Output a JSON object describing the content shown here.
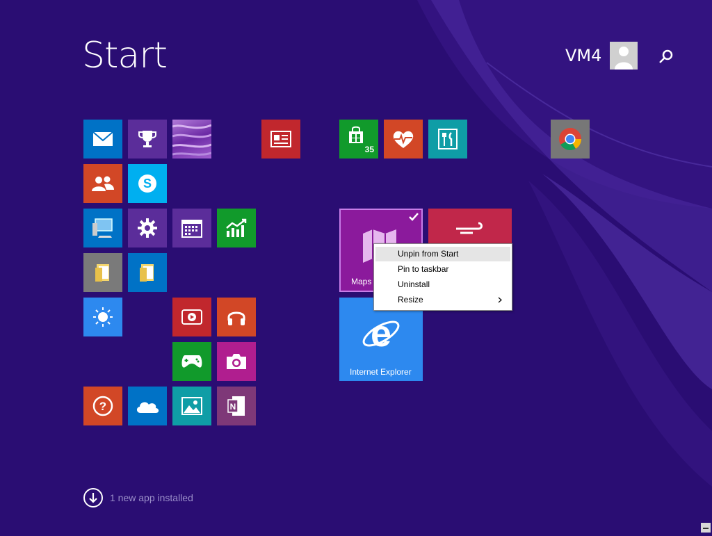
{
  "header": {
    "title": "Start",
    "user_name": "VM4",
    "avatar_icon": "user-silhouette-icon",
    "search_icon": "search-icon"
  },
  "colors": {
    "background": "#2a0d73",
    "blue": "#0072c6",
    "purple": "#5b2d9a",
    "red": "#c1272d",
    "orange": "#d24726",
    "green": "#119a2b",
    "teal": "#0f9da6"
  },
  "tiles": [
    {
      "name": "mail",
      "icon": "mail-icon",
      "color": "#0072c6"
    },
    {
      "name": "games-achievements",
      "icon": "trophy-icon",
      "color": "#5b2d9a"
    },
    {
      "name": "photo",
      "icon": "purple-photo-icon",
      "color": "#7c3aa8"
    },
    {
      "name": "news",
      "icon": "news-icon",
      "color": "#c1272d"
    },
    {
      "name": "store",
      "icon": "store-icon",
      "color": "#119a2b",
      "badge": "35"
    },
    {
      "name": "health-fitness",
      "icon": "heart-pulse-icon",
      "color": "#d24726"
    },
    {
      "name": "food-drink",
      "icon": "fork-knife-icon",
      "color": "#0f9da6"
    },
    {
      "name": "chrome",
      "icon": "chrome-icon",
      "color": "#777777"
    },
    {
      "name": "people",
      "icon": "people-icon",
      "color": "#d24726"
    },
    {
      "name": "skype",
      "icon": "skype-icon",
      "color": "#00aff0"
    },
    {
      "name": "this-pc",
      "icon": "computer-icon",
      "color": "#0072c6"
    },
    {
      "name": "settings",
      "icon": "gear-icon",
      "color": "#5b2d9a"
    },
    {
      "name": "calendar",
      "icon": "calendar-icon",
      "color": "#5b2d9a"
    },
    {
      "name": "finance",
      "icon": "chart-icon",
      "color": "#119a2b"
    },
    {
      "name": "maps",
      "icon": "maps-icon",
      "color": "#8b1a9c",
      "label": "Maps"
    },
    {
      "name": "travel",
      "icon": "travel-icon",
      "color": "#c1274a"
    },
    {
      "name": "file-explorer-1",
      "icon": "folder-icon",
      "color": "#7a7a7a"
    },
    {
      "name": "file-explorer-2",
      "icon": "folder-icon",
      "color": "#0072c6"
    },
    {
      "name": "weather",
      "icon": "sun-icon",
      "color": "#2d89ef"
    },
    {
      "name": "video",
      "icon": "play-icon",
      "color": "#c1272d"
    },
    {
      "name": "music",
      "icon": "headphones-icon",
      "color": "#d24726"
    },
    {
      "name": "internet-explorer",
      "icon": "ie-icon",
      "color": "#2d89ef",
      "label": "Internet Explorer"
    },
    {
      "name": "games",
      "icon": "gamepad-icon",
      "color": "#119a2b"
    },
    {
      "name": "camera",
      "icon": "camera-icon",
      "color": "#b01e8f"
    },
    {
      "name": "help-tips",
      "icon": "question-icon",
      "color": "#d24726"
    },
    {
      "name": "onedrive",
      "icon": "cloud-icon",
      "color": "#0072c6"
    },
    {
      "name": "photos",
      "icon": "photos-icon",
      "color": "#0f9da6"
    },
    {
      "name": "onenote",
      "icon": "onenote-icon",
      "color": "#7e3878"
    }
  ],
  "context_menu": {
    "items": [
      {
        "label": "Unpin from Start"
      },
      {
        "label": "Pin to taskbar"
      },
      {
        "label": "Uninstall"
      },
      {
        "label": "Resize",
        "submenu_icon": "chevron-right-icon"
      }
    ]
  },
  "footer": {
    "notice": "1 new app installed",
    "notice_icon": "down-arrow-icon"
  }
}
